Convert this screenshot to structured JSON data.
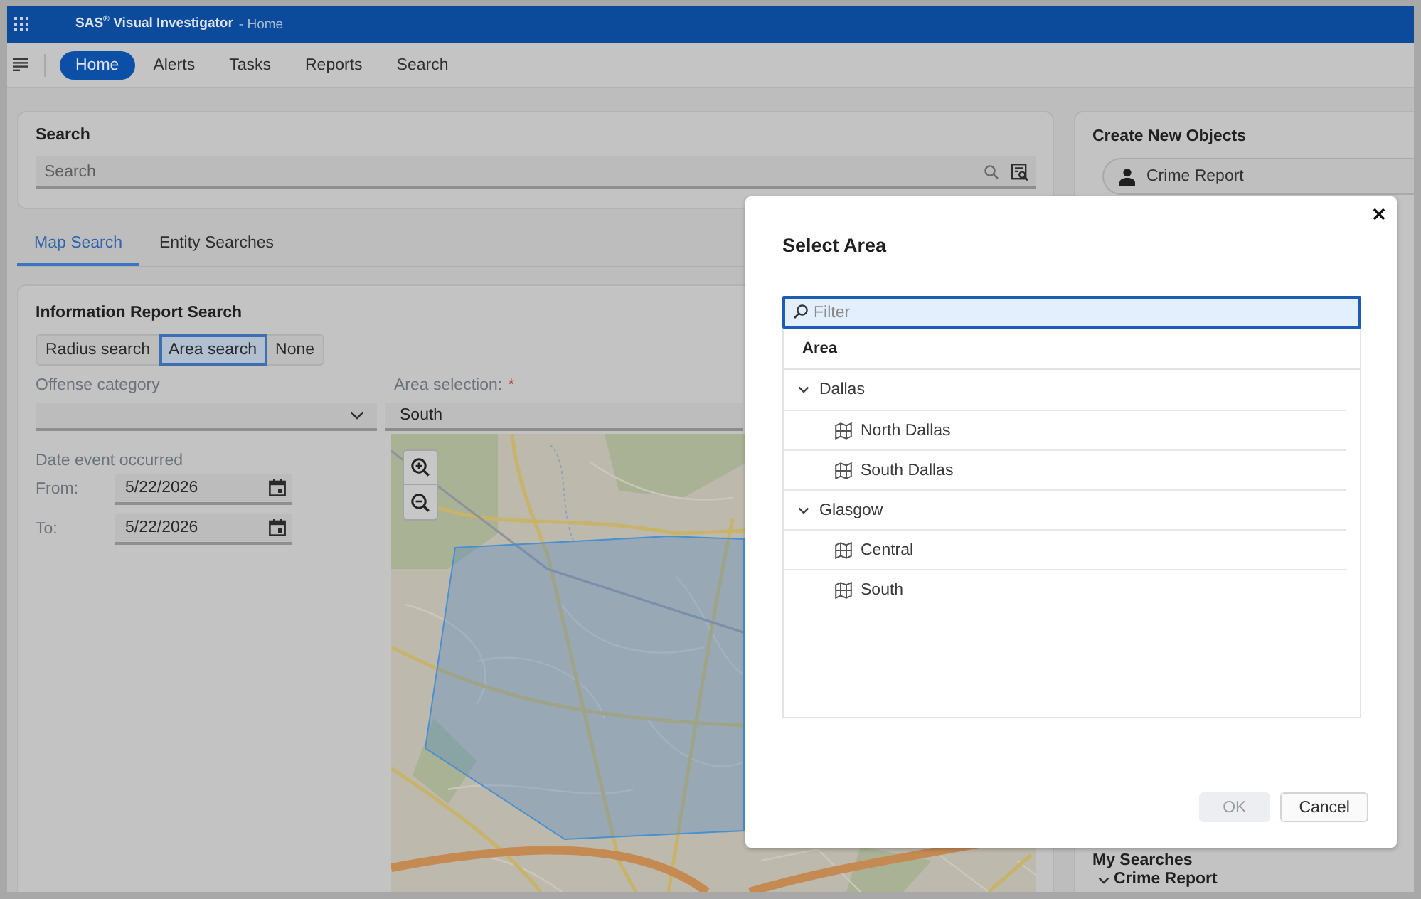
{
  "app_bar": {
    "title": "SAS$^{®}$ Visual Investigator",
    "page": "- Home"
  },
  "nav": {
    "items": [
      {
        "label": "Home",
        "selected": true
      },
      {
        "label": "Alerts",
        "selected": false
      },
      {
        "label": "Tasks",
        "selected": false
      },
      {
        "label": "Reports",
        "selected": false
      },
      {
        "label": "Search",
        "selected": false
      }
    ]
  },
  "search_card": {
    "title": "Search",
    "field": {
      "placeholder": "Search"
    }
  },
  "tabs": [
    {
      "label": "Map Search",
      "selected": true
    },
    {
      "label": "Entity Searches",
      "selected": false
    }
  ],
  "information_report_search": {
    "title": "Information Report Search",
    "search_modes": [
      {
        "label": "Radius search",
        "selected": false
      },
      {
        "label": "Area search",
        "selected": true
      },
      {
        "label": "None",
        "selected": false
      }
    ],
    "offense_category": {
      "label": "Offense category"
    },
    "area_selection": {
      "label": "Area selection:",
      "required_mark": "*",
      "value": "South"
    },
    "date_event_occurred": {
      "label": "Date event occurred",
      "from": {
        "label": "From:",
        "value": "5/22/2026"
      },
      "to": {
        "label": "To:",
        "value": "5/22/2026"
      }
    }
  },
  "create_new_objects": {
    "title": "Create New Objects",
    "items": [
      {
        "label": "Crime Report"
      }
    ]
  },
  "my_searches": {
    "title": "My Searches",
    "groups": [
      {
        "label": "Crime Report",
        "expanded": true
      }
    ]
  },
  "dialog": {
    "title": "Select Area",
    "filter": {
      "placeholder": "Filter"
    },
    "column": "Area",
    "tree": [
      {
        "label": "Dallas",
        "expanded": true,
        "children": [
          {
            "label": "North Dallas"
          },
          {
            "label": "South Dallas"
          }
        ]
      },
      {
        "label": "Glasgow",
        "expanded": true,
        "children": [
          {
            "label": "Central"
          },
          {
            "label": "South"
          }
        ]
      }
    ],
    "buttons": [
      {
        "label": "OK",
        "kind": "primary",
        "disabled": true
      },
      {
        "label": "Cancel",
        "kind": "secondary",
        "disabled": false
      }
    ]
  }
}
